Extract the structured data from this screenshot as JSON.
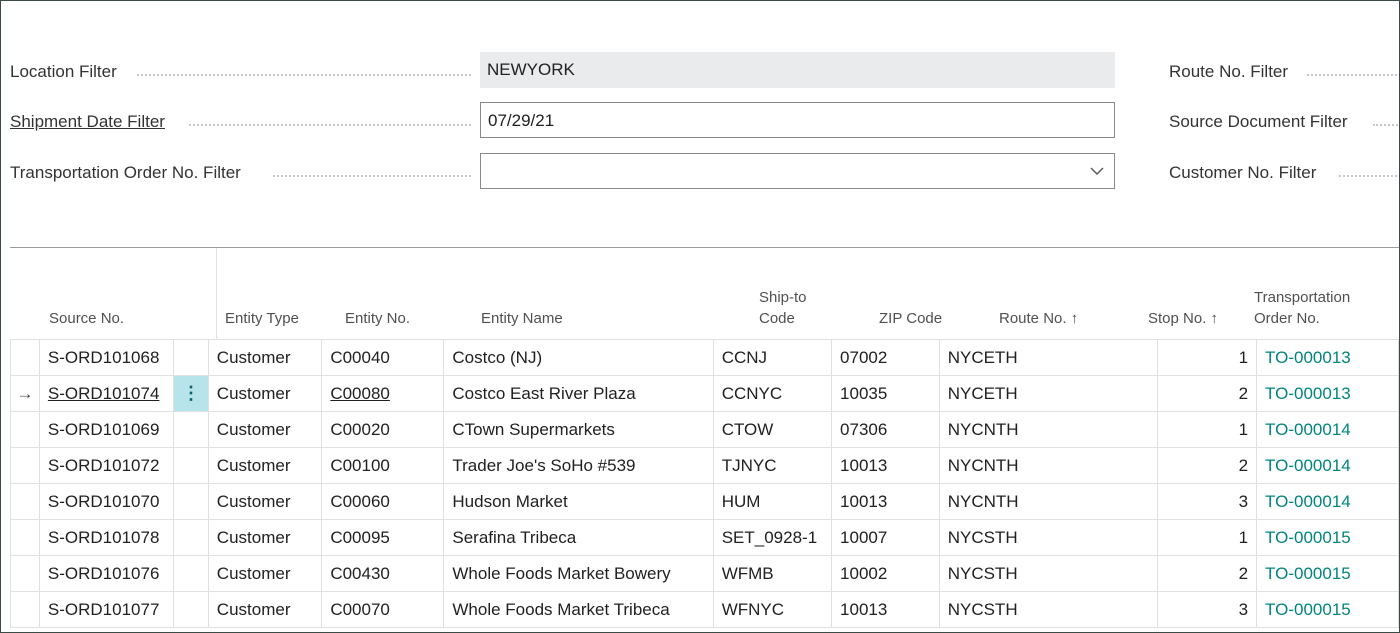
{
  "filters": {
    "location_label": "Location Filter",
    "location_value": "NEWYORK",
    "shipment_date_label": "Shipment Date Filter",
    "shipment_date_value": "07/29/21",
    "transport_order_label": "Transportation Order No. Filter",
    "transport_order_value": "",
    "route_label": "Route No. Filter",
    "source_doc_label": "Source Document Filter",
    "customer_label": "Customer No. Filter"
  },
  "table": {
    "headers": {
      "source_no": "Source No.",
      "entity_type": "Entity Type",
      "entity_no": "Entity No.",
      "entity_name": "Entity Name",
      "ship_to_1": "Ship-to",
      "ship_to_2": "Code",
      "zip": "ZIP Code",
      "route": "Route No. ↑",
      "stop": "Stop No. ↑",
      "transport_1": "Transportation",
      "transport_2": "Order No."
    },
    "selected_row_indicator": "→",
    "row_action_icon": "⋮",
    "rows": [
      {
        "source_no": "S-ORD101068",
        "entity_type": "Customer",
        "entity_no": "C00040",
        "entity_name": "Costco (NJ)",
        "ship_to": "CCNJ",
        "zip": "07002",
        "route": "NYCETH",
        "stop": "1",
        "transport": "TO-000013"
      },
      {
        "source_no": "S-ORD101074",
        "entity_type": "Customer",
        "entity_no": "C00080",
        "entity_name": "Costco East River Plaza",
        "ship_to": "CCNYC",
        "zip": "10035",
        "route": "NYCETH",
        "stop": "2",
        "transport": "TO-000013"
      },
      {
        "source_no": "S-ORD101069",
        "entity_type": "Customer",
        "entity_no": "C00020",
        "entity_name": "CTown Supermarkets",
        "ship_to": "CTOW",
        "zip": "07306",
        "route": "NYCNTH",
        "stop": "1",
        "transport": "TO-000014"
      },
      {
        "source_no": "S-ORD101072",
        "entity_type": "Customer",
        "entity_no": "C00100",
        "entity_name": "Trader Joe's SoHo #539",
        "ship_to": "TJNYC",
        "zip": "10013",
        "route": "NYCNTH",
        "stop": "2",
        "transport": "TO-000014"
      },
      {
        "source_no": "S-ORD101070",
        "entity_type": "Customer",
        "entity_no": "C00060",
        "entity_name": "Hudson Market",
        "ship_to": "HUM",
        "zip": "10013",
        "route": "NYCNTH",
        "stop": "3",
        "transport": "TO-000014"
      },
      {
        "source_no": "S-ORD101078",
        "entity_type": "Customer",
        "entity_no": "C00095",
        "entity_name": "Serafina Tribeca",
        "ship_to": "SET_0928-1",
        "zip": "10007",
        "route": "NYCSTH",
        "stop": "1",
        "transport": "TO-000015"
      },
      {
        "source_no": "S-ORD101076",
        "entity_type": "Customer",
        "entity_no": "C00430",
        "entity_name": "Whole Foods Market Bowery",
        "ship_to": "WFMB",
        "zip": "10002",
        "route": "NYCSTH",
        "stop": "2",
        "transport": "TO-000015"
      },
      {
        "source_no": "S-ORD101077",
        "entity_type": "Customer",
        "entity_no": "C00070",
        "entity_name": "Whole Foods Market Tribeca",
        "ship_to": "WFNYC",
        "zip": "10013",
        "route": "NYCSTH",
        "stop": "3",
        "transport": "TO-000015"
      }
    ]
  }
}
